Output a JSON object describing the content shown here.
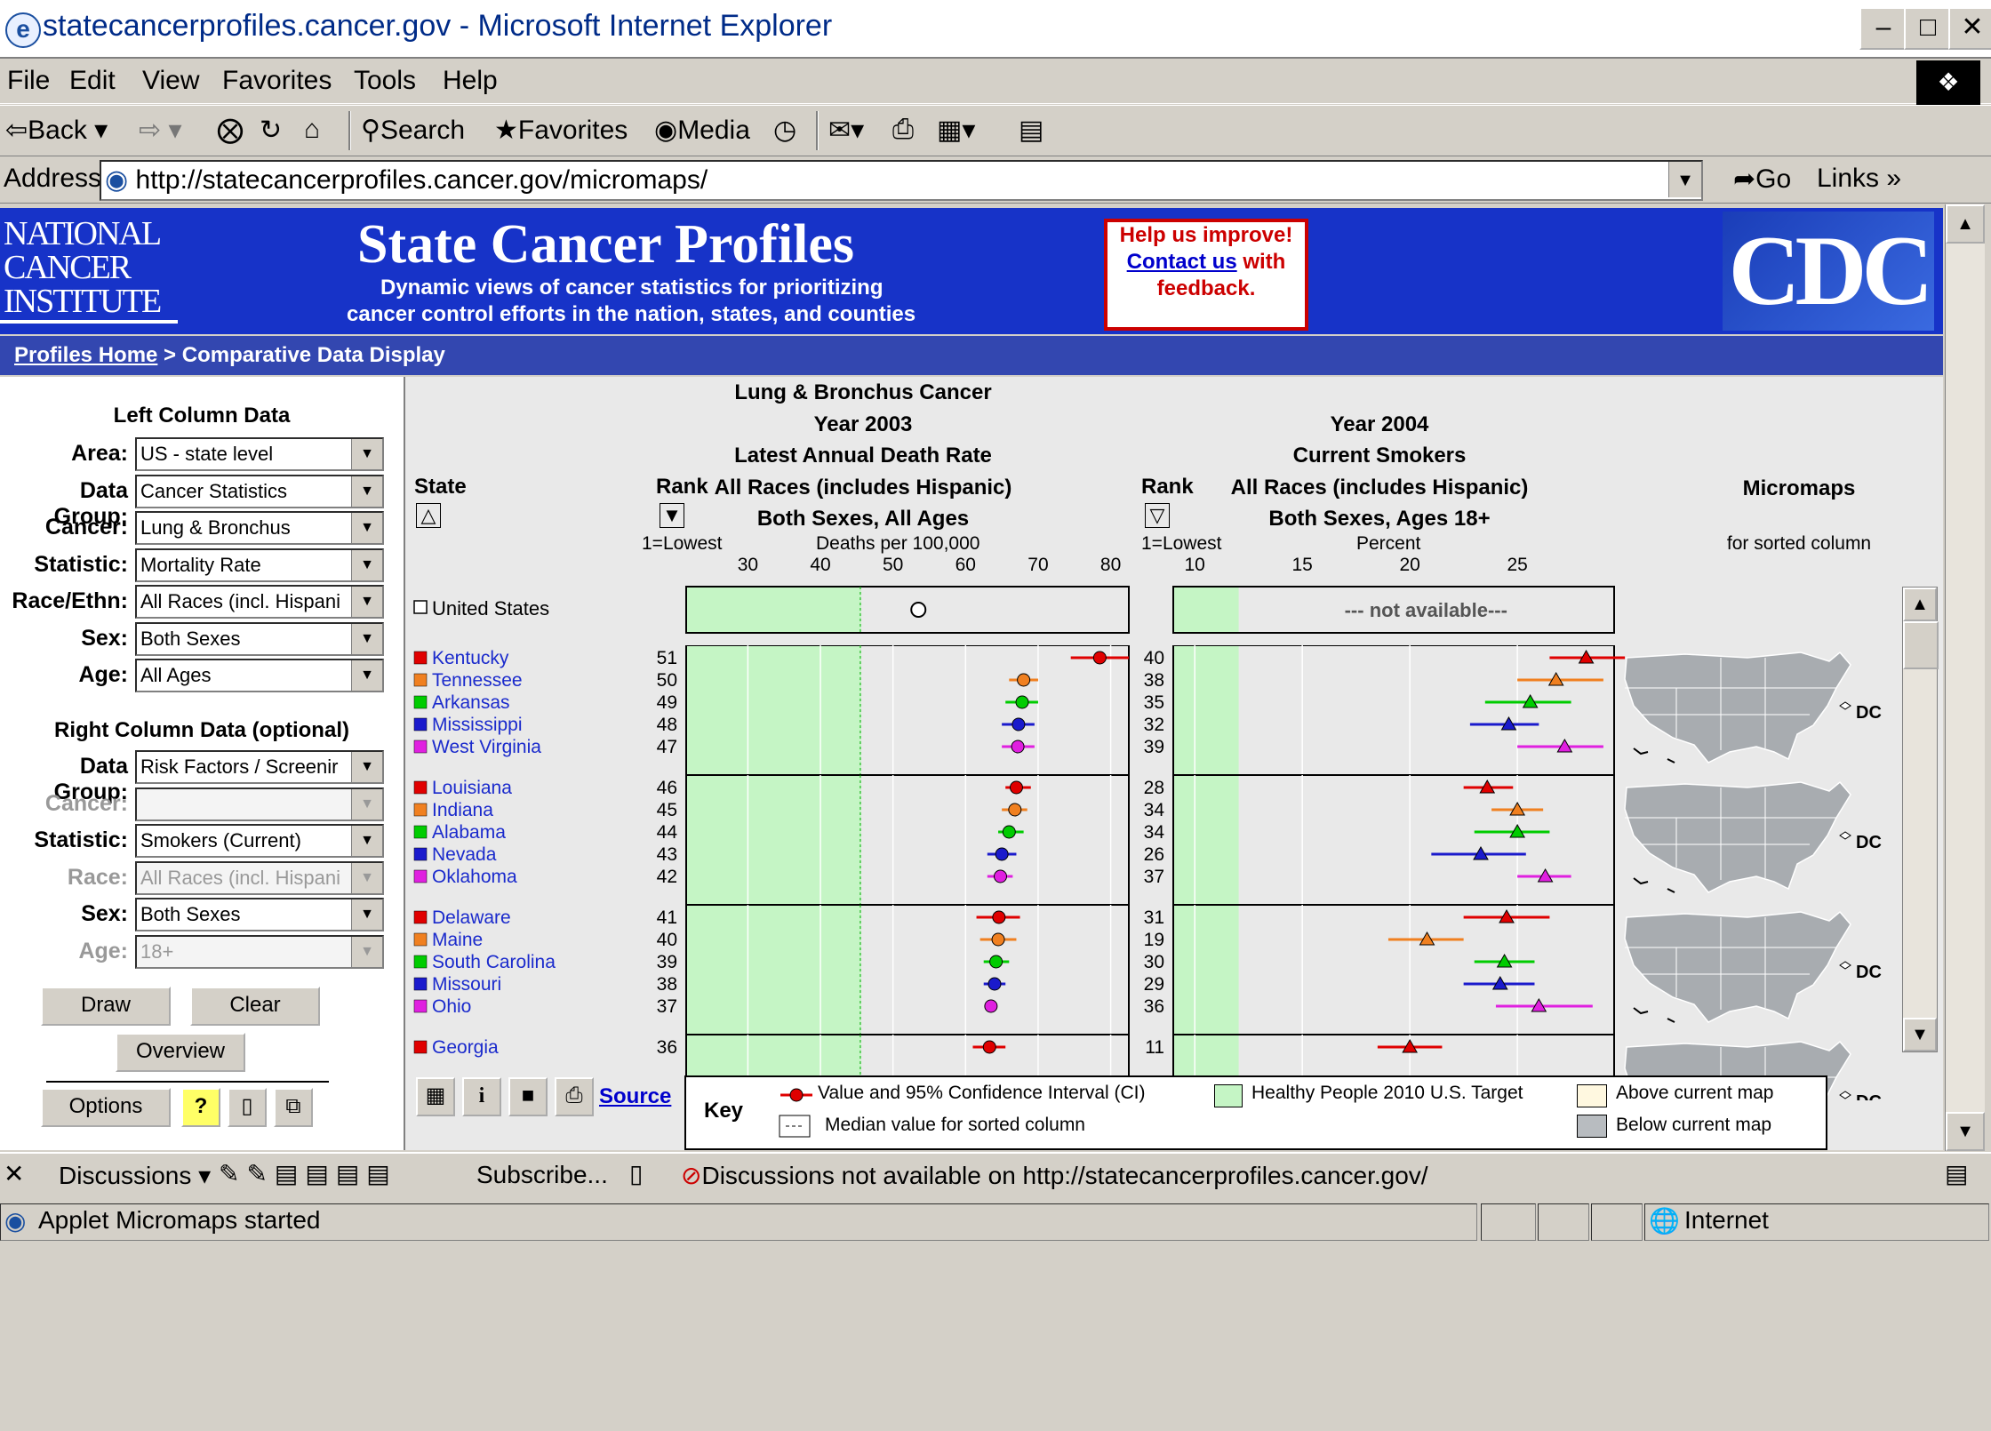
{
  "window": {
    "title": "statecancerprofiles.cancer.gov - Microsoft Internet Explorer",
    "icon": "ie-icon"
  },
  "menu": [
    "File",
    "Edit",
    "View",
    "Favorites",
    "Tools",
    "Help"
  ],
  "toolbar": {
    "back": "Back",
    "search": "Search",
    "favorites": "Favorites",
    "media": "Media"
  },
  "address": {
    "label": "Address",
    "url": "http://statecancerprofiles.cancer.gov/micromaps/",
    "go": "Go",
    "links": "Links"
  },
  "banner": {
    "nci": [
      "NATIONAL",
      "CANCER",
      "INSTITUTE"
    ],
    "title": "State Cancer Profiles",
    "sub1": "Dynamic views of cancer statistics for prioritizing",
    "sub2": "cancer control efforts in the nation, states, and counties",
    "help1": "Help us improve!",
    "help_link": "Contact us",
    "help2": "with",
    "help3": "feedback.",
    "cdc": "CDC"
  },
  "breadcrumb": {
    "home": "Profiles Home",
    "sep": " > ",
    "current": "Comparative Data Display"
  },
  "left_panel": {
    "left_title": "Left Column Data",
    "left_fields": [
      {
        "label": "Area:",
        "value": "US - state level",
        "disabled": false
      },
      {
        "label": "Data Group:",
        "value": "Cancer Statistics",
        "disabled": false
      },
      {
        "label": "Cancer:",
        "value": "Lung & Bronchus",
        "disabled": false
      },
      {
        "label": "Statistic:",
        "value": "Mortality Rate",
        "disabled": false
      },
      {
        "label": "Race/Ethn:",
        "value": "All Races (incl. Hispani",
        "disabled": false
      },
      {
        "label": "Sex:",
        "value": "Both Sexes",
        "disabled": false
      },
      {
        "label": "Age:",
        "value": "All Ages",
        "disabled": false
      }
    ],
    "right_title": "Right Column Data (optional)",
    "right_fields": [
      {
        "label": "Data Group:",
        "value": "Risk Factors / Screenir",
        "disabled": false
      },
      {
        "label": "Cancer:",
        "value": "",
        "disabled": true
      },
      {
        "label": "Statistic:",
        "value": "Smokers (Current)",
        "disabled": false
      },
      {
        "label": "Race:",
        "value": "All Races (incl. Hispani",
        "disabled": true
      },
      {
        "label": "Sex:",
        "value": "Both Sexes",
        "disabled": false
      },
      {
        "label": "Age:",
        "value": "18+",
        "disabled": true
      }
    ],
    "draw": "Draw",
    "clear": "Clear",
    "overview": "Overview",
    "options": "Options"
  },
  "headers": {
    "state": "State",
    "rank": "Rank",
    "rank_note": "1=Lowest",
    "left": [
      "Lung & Bronchus Cancer",
      "Year 2003",
      "Latest Annual Death Rate",
      "All Races (includes Hispanic)",
      "Both Sexes, All Ages"
    ],
    "left_unit": "Deaths per 100,000",
    "right": [
      "Year 2004",
      "Current Smokers",
      "All Races (includes Hispanic)",
      "Both Sexes, Ages 18+"
    ],
    "right_unit": "Percent",
    "micromaps": "Micromaps",
    "micromaps_note": "for sorted column",
    "not_available": "--- not available---",
    "dc": "DC",
    "source": "Source"
  },
  "us_row": {
    "label": "United States",
    "left_value": 53.5
  },
  "chart_data": {
    "type": "scatter",
    "left_axis": {
      "ticks": [
        30,
        40,
        50,
        60,
        70,
        80
      ],
      "xlim": [
        21.5,
        82.5
      ],
      "target_max": 45.5
    },
    "right_axis": {
      "ticks": [
        10,
        15,
        20,
        25
      ],
      "xlim": [
        9,
        29.5
      ],
      "target_max": 12
    },
    "series": [
      {
        "group": 1,
        "state": "Kentucky",
        "color": "#e00000",
        "left_rank": "51",
        "left_value": 78.5,
        "left_ci": [
          74.5,
          82.5
        ],
        "right_rank": "40",
        "right_value": 28.2,
        "right_ci": [
          26.5,
          30
        ]
      },
      {
        "group": 1,
        "state": "Tennessee",
        "color": "#f08020",
        "left_rank": "50",
        "left_value": 68.0,
        "left_ci": [
          66,
          70
        ],
        "right_rank": "38",
        "right_value": 26.8,
        "right_ci": [
          25,
          29
        ]
      },
      {
        "group": 1,
        "state": "Arkansas",
        "color": "#00cc00",
        "left_rank": "49",
        "left_value": 67.8,
        "left_ci": [
          65.5,
          70
        ],
        "right_rank": "35",
        "right_value": 25.6,
        "right_ci": [
          23.5,
          27.5
        ]
      },
      {
        "group": 1,
        "state": "Mississippi",
        "color": "#1a1acc",
        "left_rank": "48",
        "left_value": 67.3,
        "left_ci": [
          65,
          69.5
        ],
        "right_rank": "32",
        "right_value": 24.6,
        "right_ci": [
          22.8,
          26
        ]
      },
      {
        "group": 1,
        "state": "West Virginia",
        "color": "#e020e0",
        "left_rank": "47",
        "left_value": 67.2,
        "left_ci": [
          65,
          69.5
        ],
        "right_rank": "39",
        "right_value": 27.2,
        "right_ci": [
          25,
          29
        ]
      },
      {
        "group": 2,
        "state": "Louisiana",
        "color": "#e00000",
        "left_rank": "46",
        "left_value": 67.0,
        "left_ci": [
          65.5,
          69
        ],
        "right_rank": "28",
        "right_value": 23.6,
        "right_ci": [
          22.5,
          24.8
        ]
      },
      {
        "group": 2,
        "state": "Indiana",
        "color": "#f08020",
        "left_rank": "45",
        "left_value": 66.8,
        "left_ci": [
          65,
          68.5
        ],
        "right_rank": "34",
        "right_value": 25.0,
        "right_ci": [
          23.8,
          26.2
        ]
      },
      {
        "group": 2,
        "state": "Alabama",
        "color": "#00cc00",
        "left_rank": "44",
        "left_value": 66.0,
        "left_ci": [
          64.5,
          68
        ],
        "right_rank": "34",
        "right_value": 25.0,
        "right_ci": [
          23,
          26.5
        ]
      },
      {
        "group": 2,
        "state": "Nevada",
        "color": "#1a1acc",
        "left_rank": "43",
        "left_value": 65.0,
        "left_ci": [
          63,
          67
        ],
        "right_rank": "26",
        "right_value": 23.3,
        "right_ci": [
          21,
          25.4
        ]
      },
      {
        "group": 2,
        "state": "Oklahoma",
        "color": "#e020e0",
        "left_rank": "42",
        "left_value": 64.8,
        "left_ci": [
          63,
          66.5
        ],
        "right_rank": "37",
        "right_value": 26.3,
        "right_ci": [
          25,
          27.5
        ]
      },
      {
        "group": 3,
        "state": "Delaware",
        "color": "#e00000",
        "left_rank": "41",
        "left_value": 64.6,
        "left_ci": [
          61.5,
          67.5
        ],
        "right_rank": "31",
        "right_value": 24.5,
        "right_ci": [
          22.5,
          26.5
        ]
      },
      {
        "group": 3,
        "state": "Maine",
        "color": "#f08020",
        "left_rank": "40",
        "left_value": 64.5,
        "left_ci": [
          62,
          67
        ],
        "right_rank": "19",
        "right_value": 20.8,
        "right_ci": [
          19,
          22.5
        ]
      },
      {
        "group": 3,
        "state": "South Carolina",
        "color": "#00cc00",
        "left_rank": "39",
        "left_value": 64.2,
        "left_ci": [
          62.5,
          66
        ],
        "right_rank": "30",
        "right_value": 24.4,
        "right_ci": [
          23,
          25.8
        ]
      },
      {
        "group": 3,
        "state": "Missouri",
        "color": "#1a1acc",
        "left_rank": "38",
        "left_value": 64.0,
        "left_ci": [
          62.5,
          65.5
        ],
        "right_rank": "29",
        "right_value": 24.2,
        "right_ci": [
          22.5,
          25.8
        ]
      },
      {
        "group": 3,
        "state": "Ohio",
        "color": "#e020e0",
        "left_rank": "37",
        "left_value": 63.5,
        "left_ci": [
          63,
          64
        ],
        "right_rank": "36",
        "right_value": 26.0,
        "right_ci": [
          24,
          28.5
        ]
      },
      {
        "group": 4,
        "state": "Georgia",
        "color": "#e00000",
        "left_rank": "36",
        "left_value": 63.3,
        "left_ci": [
          61,
          65.5
        ],
        "right_rank": "11",
        "right_value": 20.0,
        "right_ci": [
          18.5,
          21.5
        ]
      }
    ]
  },
  "key": {
    "title": "Key",
    "ci": "Value and 95% Confidence Interval (CI)",
    "median": "Median value for sorted column",
    "target": "Healthy People 2010 U.S. Target",
    "above": "Above current map",
    "below": "Below current map"
  },
  "discussions": {
    "label": "Discussions",
    "subscribe": "Subscribe...",
    "message": "Discussions not available on http://statecancerprofiles.cancer.gov/"
  },
  "status": {
    "text": "Applet Micromaps started",
    "zone": "Internet"
  }
}
